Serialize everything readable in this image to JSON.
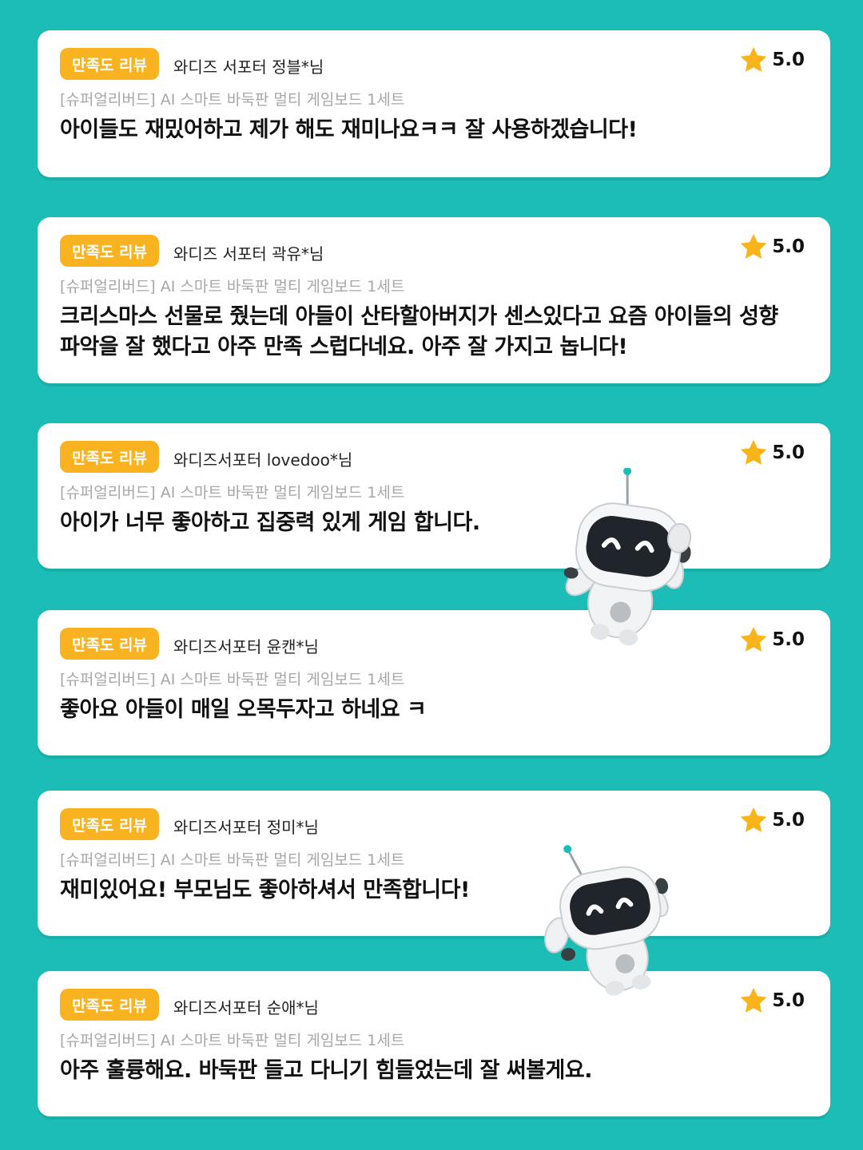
{
  "colors": {
    "background": "#1cbdb7",
    "badge": "#f9b320",
    "star": "#f8b419"
  },
  "reviews": [
    {
      "badge": "만족도 리뷰",
      "reviewer": "와디즈 서포터 정블*님",
      "product": "[슈퍼얼리버드] AI 스마트 바둑판 멀티 게임보드 1세트",
      "rating": "5.0",
      "text": "아이들도 재밌어하고 제가 해도 재미나요ㅋㅋ 잘 사용하겠습니다!"
    },
    {
      "badge": "만족도 리뷰",
      "reviewer": "와디즈 서포터 곽유*님",
      "product": "[슈퍼얼리버드] AI 스마트 바둑판 멀티 게임보드 1세트",
      "rating": "5.0",
      "text": "크리스마스 선물로 줬는데 아들이 산타할아버지가 센스있다고 요즘 아이들의 성향파악을 잘 했다고 아주 만족 스럽다네요. 아주 잘 가지고 놉니다!"
    },
    {
      "badge": "만족도 리뷰",
      "reviewer": "와디즈서포터 lovedoo*님",
      "product": "[슈퍼얼리버드] AI 스마트 바둑판 멀티 게임보드 1세트",
      "rating": "5.0",
      "text": "아이가 너무 좋아하고 집중력 있게 게임 합니다."
    },
    {
      "badge": "만족도 리뷰",
      "reviewer": "와디즈서포터 윤캔*님",
      "product": "[슈퍼얼리버드] AI 스마트 바둑판 멀티 게임보드 1세트",
      "rating": "5.0",
      "text": "좋아요 아들이 매일 오목두자고 하네요 ㅋ"
    },
    {
      "badge": "만족도 리뷰",
      "reviewer": "와디즈서포터 정미*님",
      "product": "[슈퍼얼리버드] AI 스마트 바둑판 멀티 게임보드 1세트",
      "rating": "5.0",
      "text": "재미있어요! 부모님도 좋아하셔서 만족합니다!"
    },
    {
      "badge": "만족도 리뷰",
      "reviewer": "와디즈서포터 순애*님",
      "product": "[슈퍼얼리버드] AI 스마트 바둑판 멀티 게임보드 1세트",
      "rating": "5.0",
      "text": "아주 훌륭해요. 바둑판 들고 다니기 힘들었는데 잘 써볼게요."
    }
  ]
}
